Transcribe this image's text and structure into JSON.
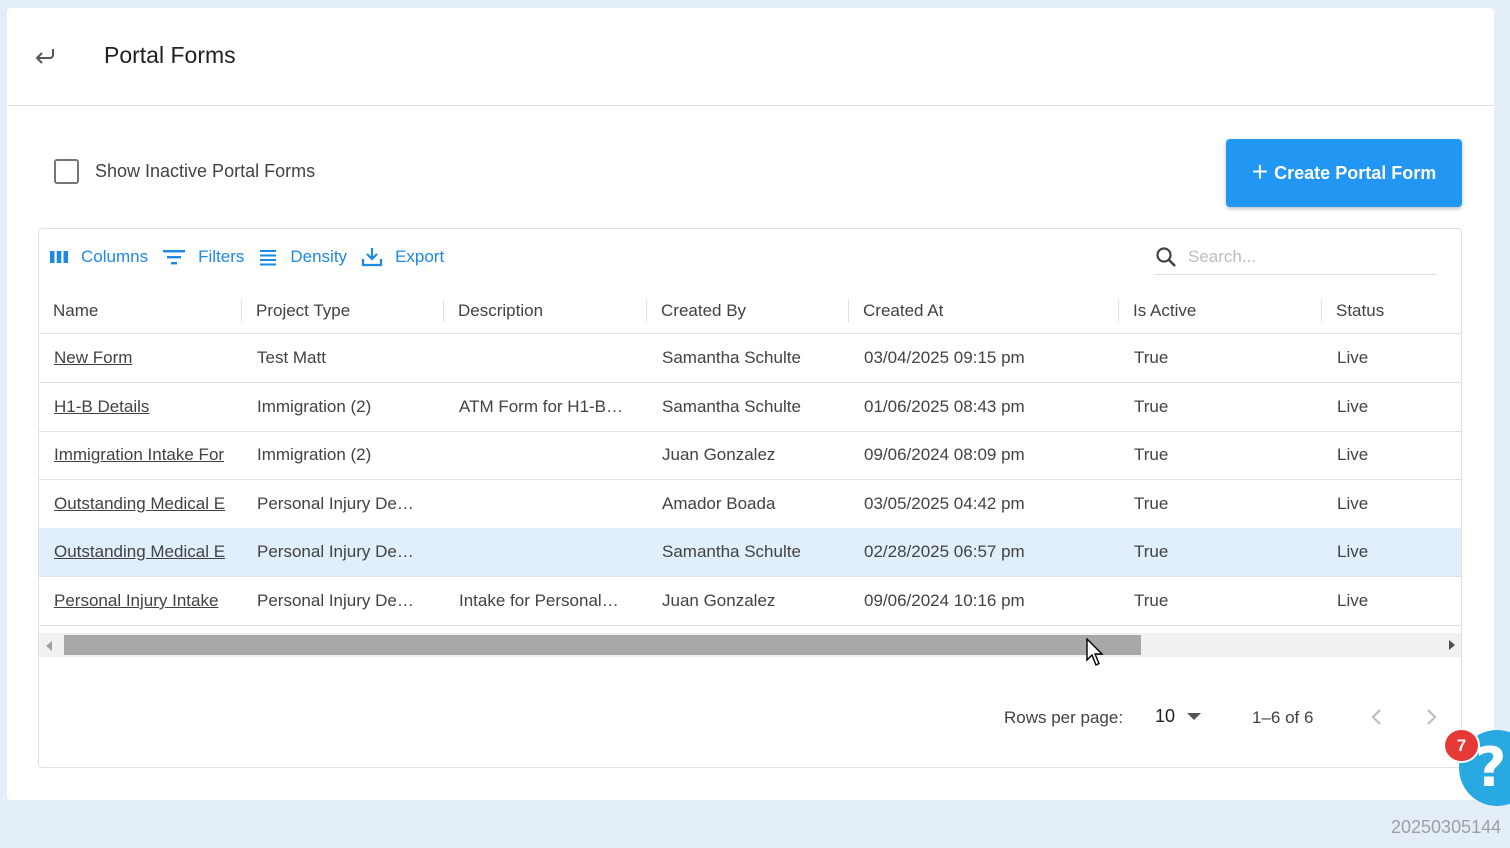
{
  "header": {
    "title": "Portal Forms",
    "back_icon": "back-arrow-icon"
  },
  "filters": {
    "show_inactive_label": "Show Inactive Portal Forms",
    "show_inactive_checked": false
  },
  "create_button": {
    "label": "Create Portal Form",
    "color": "#2196f3"
  },
  "toolbar": {
    "columns": "Columns",
    "filters": "Filters",
    "density": "Density",
    "export": "Export",
    "accent": "#1e88e5"
  },
  "search": {
    "placeholder": "Search..."
  },
  "table": {
    "columns": [
      "Name",
      "Project Type",
      "Description",
      "Created By",
      "Created At",
      "Is Active",
      "Status"
    ],
    "rows": [
      {
        "name": "New Form",
        "project_type": "Test Matt",
        "description": "",
        "created_by": "Samantha Schulte",
        "created_at": "03/04/2025 09:15 pm",
        "is_active": "True",
        "status": "Live"
      },
      {
        "name": "H1-B Details",
        "project_type": "Immigration (2)",
        "description": "ATM Form for H1-B…",
        "created_by": "Samantha Schulte",
        "created_at": "01/06/2025 08:43 pm",
        "is_active": "True",
        "status": "Live"
      },
      {
        "name": "Immigration Intake For",
        "project_type": "Immigration (2)",
        "description": "",
        "created_by": "Juan Gonzalez",
        "created_at": "09/06/2024 08:09 pm",
        "is_active": "True",
        "status": "Live"
      },
      {
        "name": "Outstanding Medical E",
        "project_type": "Personal Injury De…",
        "description": "",
        "created_by": "Amador Boada",
        "created_at": "03/05/2025 04:42 pm",
        "is_active": "True",
        "status": "Live"
      },
      {
        "name": "Outstanding Medical E",
        "project_type": "Personal Injury De…",
        "description": "",
        "created_by": "Samantha Schulte",
        "created_at": "02/28/2025 06:57 pm",
        "is_active": "True",
        "status": "Live"
      },
      {
        "name": "Personal Injury Intake",
        "project_type": "Personal Injury De…",
        "description": "Intake for Personal…",
        "created_by": "Juan Gonzalez",
        "created_at": "09/06/2024 10:16 pm",
        "is_active": "True",
        "status": "Live"
      }
    ],
    "selected_row": 4
  },
  "pagination": {
    "rows_per_page_label": "Rows per page:",
    "rows_per_page": "10",
    "range": "1–6 of 6"
  },
  "help": {
    "badge_count": "7",
    "icon": "?"
  },
  "footer": {
    "version": "20250305144"
  }
}
